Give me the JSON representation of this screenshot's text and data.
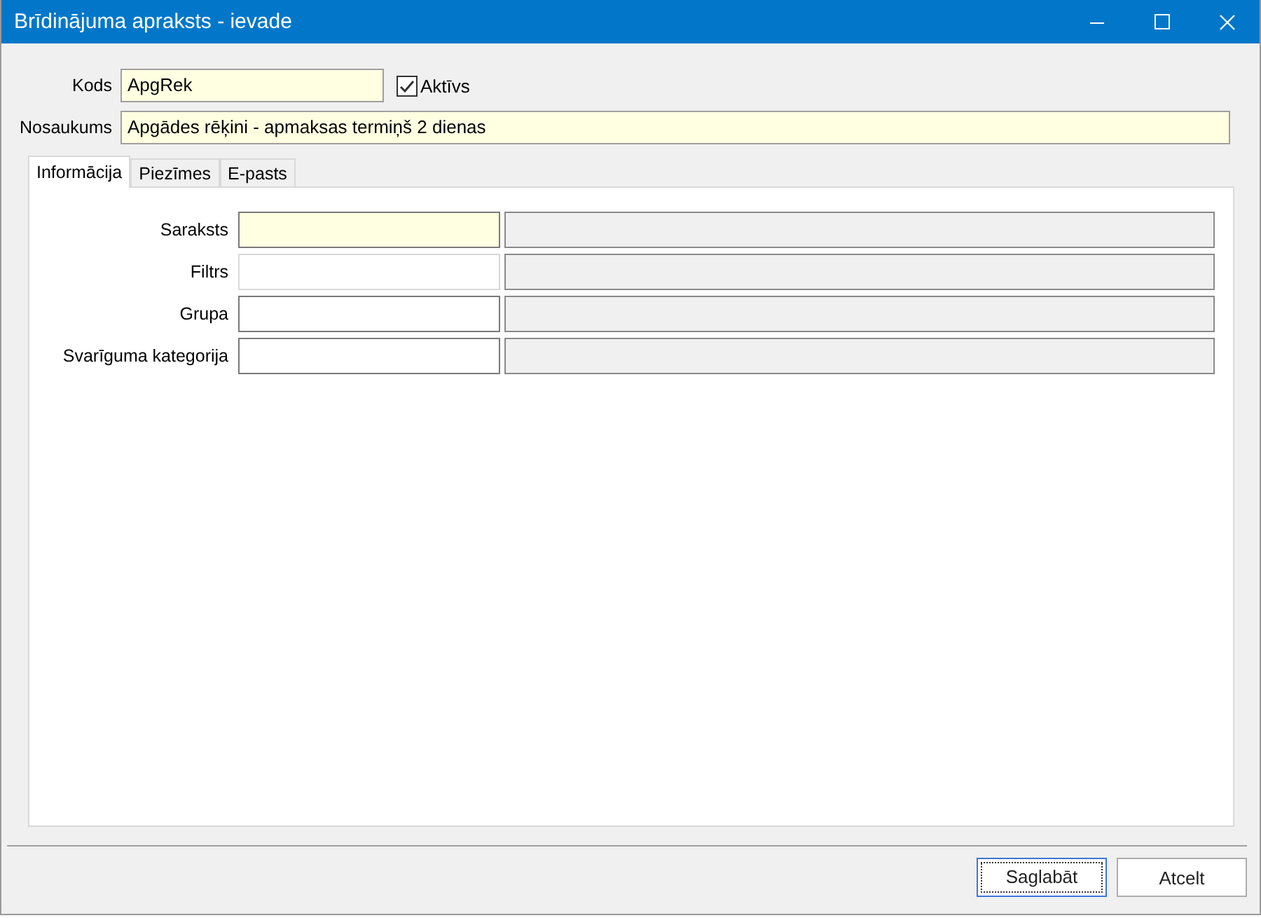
{
  "window": {
    "title": "Brīdinājuma apraksts - ievade"
  },
  "header_fields": [
    {
      "label": "Kods",
      "value": "ApgRek",
      "required": true
    },
    {
      "label": "Nosaukums",
      "value": "Apgādes rēķini - apmaksas termiņš 2 dienas",
      "required": true
    }
  ],
  "active_checkbox": {
    "label": "Aktīvs",
    "checked": true
  },
  "tabs": [
    {
      "label": "Informācija",
      "selected": true
    },
    {
      "label": "Piezīmes",
      "selected": false
    },
    {
      "label": "E-pasts",
      "selected": false
    }
  ],
  "rows": [
    {
      "label": "Saraksts",
      "required": true,
      "disabled": false
    },
    {
      "label": "Filtrs",
      "required": false,
      "disabled": true
    },
    {
      "label": "Grupa",
      "required": false,
      "disabled": false
    },
    {
      "label": "Svarīguma kategorija",
      "required": false,
      "disabled": false
    }
  ],
  "buttons": [
    {
      "label": "Saglabāt",
      "default": true
    },
    {
      "label": "Atcelt",
      "default": false
    }
  ]
}
